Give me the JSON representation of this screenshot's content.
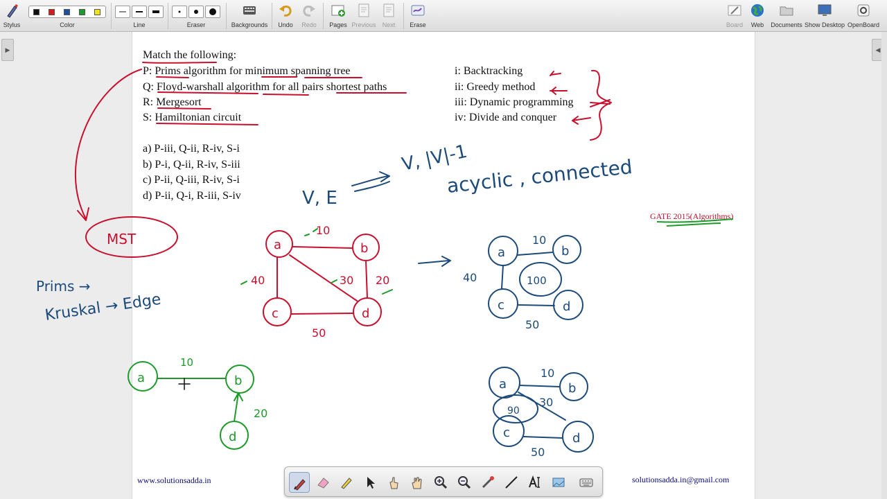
{
  "toolbar": {
    "stylus_label": "Stylus",
    "color_label": "Color",
    "colors": [
      "#111111",
      "#d41c1c",
      "#1f4ea0",
      "#1e9a2a",
      "#f0e21e"
    ],
    "line_label": "Line",
    "eraser_label": "Eraser",
    "backgrounds_label": "Backgrounds",
    "undo_label": "Undo",
    "redo_label": "Redo",
    "pages_label": "Pages",
    "previous_label": "Previous",
    "next_label": "Next",
    "erase_label": "Erase",
    "board_label": "Board",
    "web_label": "Web",
    "documents_label": "Documents",
    "show_desktop_label": "Show Desktop",
    "openboard_label": "OpenBoard"
  },
  "question": {
    "heading": "Match the following:",
    "left_items": [
      "P: Prims algorithm for minimum spanning tree",
      "Q: Floyd-warshall algorithm for all pairs shortest paths",
      "R: Mergesort",
      "S: Hamiltonian circuit"
    ],
    "right_items": [
      "i: Backtracking",
      "ii: Greedy method",
      "iii: Dynamic programming",
      "iv: Divide and conquer"
    ],
    "options": [
      "a) P-iii, Q-ii, R-iv, S-i",
      "b) P-i, Q-ii, R-iv, S-iii",
      "c) P-ii, Q-iii, R-iv, S-i",
      "d) P-ii, Q-i, R-iii, S-iv"
    ],
    "source_tag": "GATE 2015(Algorithms)"
  },
  "handwriting": {
    "ve": "V, E",
    "v_count": "V, |V|-1",
    "acyclic": "acyclic , connected",
    "mst": "MST",
    "prims": "Prims →",
    "kruskal": "Kruskal → Edge",
    "g1_weights": [
      "10",
      "30",
      "20",
      "40",
      "50"
    ],
    "g2_weights": [
      "10",
      "40",
      "100",
      "50"
    ],
    "g3_weights": [
      "10",
      "30",
      "90",
      "50"
    ],
    "g4_weights": [
      "10",
      "20"
    ],
    "node_labels": [
      "a",
      "b",
      "c",
      "d"
    ]
  },
  "footer": {
    "website": "www.solutionsadda.in",
    "email": "solutionsadda.in@gmail.com"
  },
  "colors": {
    "ink_red": "#c8102e",
    "ink_blue": "#1c4a7a",
    "ink_green": "#1d9a2a"
  }
}
